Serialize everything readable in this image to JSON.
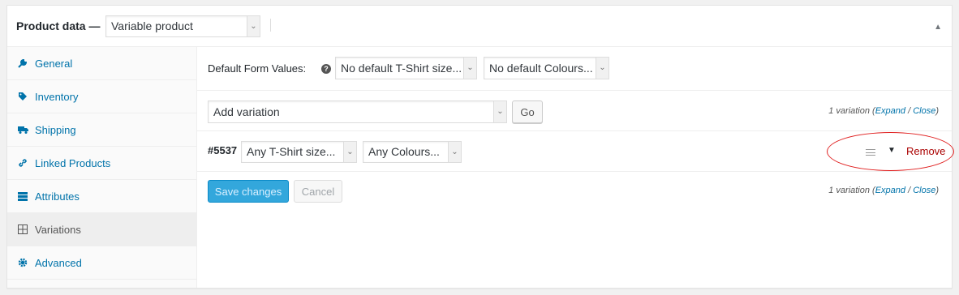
{
  "header": {
    "title": "Product data —",
    "product_type": "Variable product"
  },
  "tabs": [
    {
      "label": "General",
      "icon": "wrench-icon"
    },
    {
      "label": "Inventory",
      "icon": "tag-icon"
    },
    {
      "label": "Shipping",
      "icon": "truck-icon"
    },
    {
      "label": "Linked Products",
      "icon": "link-icon"
    },
    {
      "label": "Attributes",
      "icon": "list-icon"
    },
    {
      "label": "Variations",
      "icon": "grid-icon",
      "active": true
    },
    {
      "label": "Advanced",
      "icon": "gear-icon"
    }
  ],
  "defaults": {
    "label": "Default Form Values:",
    "help": "?",
    "tshirt_select": "No default T-Shirt size...",
    "colour_select": "No default Colours..."
  },
  "add_variation": {
    "select": "Add variation",
    "go": "Go",
    "count_text": "1 variation (",
    "expand": "Expand",
    "slash": " / ",
    "close": "Close",
    "end": ")"
  },
  "variation": {
    "id": "#5537",
    "tshirt_select": "Any T-Shirt size...",
    "colour_select": "Any Colours...",
    "remove": "Remove"
  },
  "footer": {
    "save": "Save changes",
    "cancel": "Cancel",
    "count_text": "1 variation (",
    "expand": "Expand",
    "slash": " / ",
    "close": "Close",
    "end": ")"
  },
  "colors": {
    "link": "#0073aa",
    "remove": "#aa0000",
    "primary_button": "#33a7dc",
    "annotation": "#e02020"
  }
}
